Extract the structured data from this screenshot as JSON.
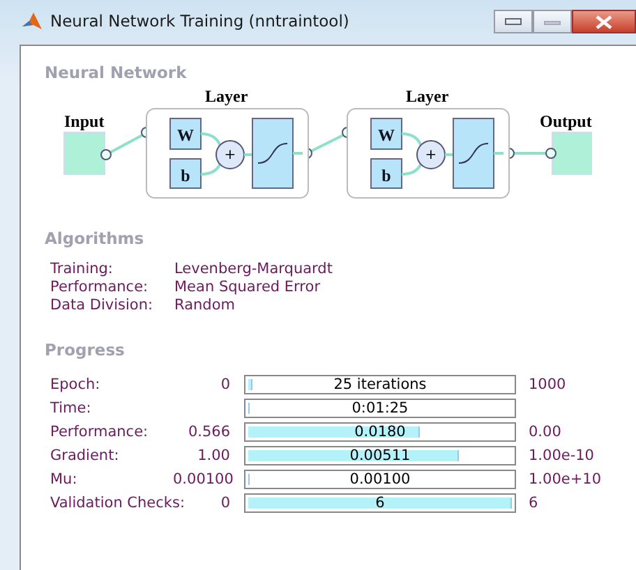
{
  "window": {
    "title": "Neural Network Training (nntraintool)"
  },
  "neural_network": {
    "heading": "Neural Network",
    "input_label": "Input",
    "output_label": "Output",
    "layers": [
      {
        "title": "Layer",
        "weight": "W",
        "bias": "b",
        "sum": "+"
      },
      {
        "title": "Layer",
        "weight": "W",
        "bias": "b",
        "sum": "+"
      }
    ]
  },
  "algorithms": {
    "heading": "Algorithms",
    "rows": [
      {
        "label": "Training:",
        "value": "Levenberg-Marquardt"
      },
      {
        "label": "Performance:",
        "value": "Mean Squared Error"
      },
      {
        "label": "Data Division:",
        "value": "Random"
      }
    ]
  },
  "progress": {
    "heading": "Progress",
    "rows": [
      {
        "label": "Epoch:",
        "start": "0",
        "reading": "25 iterations",
        "level": 0.015,
        "end": "1000"
      },
      {
        "label": "Time:",
        "reading": "0:01:25",
        "level": 0
      },
      {
        "label": "Performance:",
        "start": "0.566",
        "reading": "0.0180",
        "level": 0.635,
        "end": "0.00"
      },
      {
        "label": "Gradient:",
        "start": "1.00",
        "reading": "0.00511",
        "level": 0.78,
        "end": "1.00e-10"
      },
      {
        "label": "Mu:",
        "start": "0.00100",
        "reading": "0.00100",
        "level": 0,
        "end": "1.00e+10"
      },
      {
        "label": "Validation Checks:",
        "start": "0",
        "reading": "6",
        "level": 1,
        "end": "6"
      }
    ]
  }
}
